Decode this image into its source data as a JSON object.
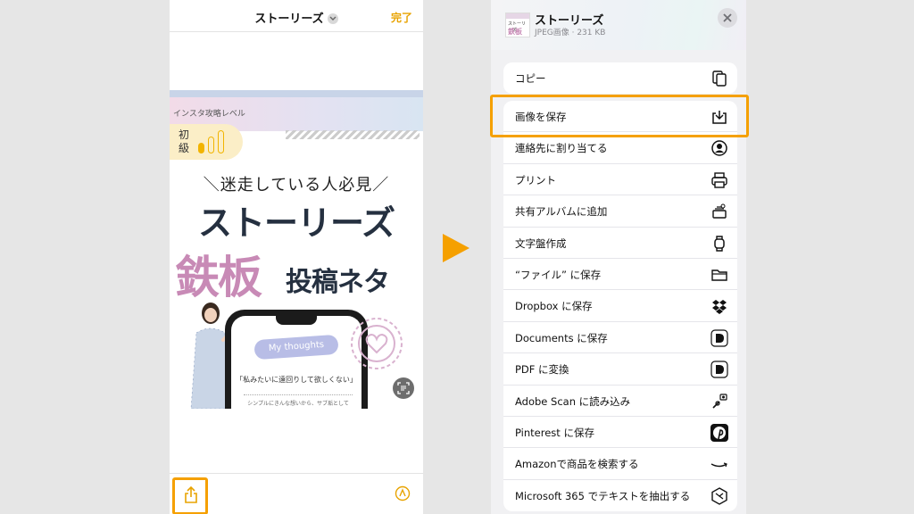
{
  "left": {
    "title": "ストーリーズ",
    "done_label": "完了",
    "story": {
      "tag": "インスタ攻略レベル",
      "level_label": "初級",
      "subtitle": "＼迷走している人必見／",
      "main": "ストーリーズ",
      "big": "鉄板",
      "big2": "投稿ネタ",
      "thought": "My thoughts",
      "quote": "「私みたいに遠回りして欲しくない」",
      "small_text": "シンプルにきんな想いから、サブ垢として"
    },
    "toolbar": {
      "share_icon": "share-icon",
      "markup_icon": "markup-icon"
    }
  },
  "right": {
    "title": "ストーリーズ",
    "subtitle": "JPEG画像 · 231 KB",
    "close_icon": "close-icon",
    "thumb_text": "ストーリーズ",
    "thumb_text2": "鉄板",
    "copy": {
      "label": "コピー",
      "icon": "copy-icon"
    },
    "actions": [
      {
        "label": "画像を保存",
        "icon": "save-image-icon"
      },
      {
        "label": "連絡先に割り当てる",
        "icon": "contact-icon"
      },
      {
        "label": "プリント",
        "icon": "printer-icon"
      },
      {
        "label": "共有アルバムに追加",
        "icon": "shared-album-icon"
      },
      {
        "label": "文字盤作成",
        "icon": "watch-icon"
      },
      {
        "label": "“ファイル” に保存",
        "icon": "folder-icon"
      },
      {
        "label": "Dropbox に保存",
        "icon": "dropbox-icon"
      },
      {
        "label": "Documents に保存",
        "icon": "documents-icon"
      },
      {
        "label": "PDF に変換",
        "icon": "pdf-icon"
      },
      {
        "label": "Adobe Scan に読み込み",
        "icon": "adobe-scan-icon"
      },
      {
        "label": "Pinterest に保存",
        "icon": "pinterest-icon"
      },
      {
        "label": "Amazonで商品を検索する",
        "icon": "amazon-icon"
      },
      {
        "label": "Microsoft 365 でテキストを抽出する",
        "icon": "microsoft-365-icon"
      }
    ]
  },
  "colors": {
    "accent": "#f5a000",
    "done": "#e8a300",
    "pink": "#c88ab6",
    "navy": "#253040"
  }
}
